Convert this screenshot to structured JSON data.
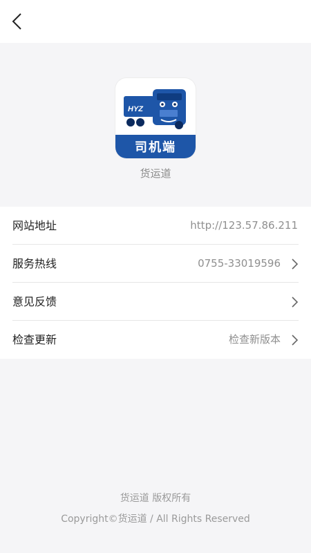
{
  "app": {
    "icon_band_text": "司机端",
    "icon_badge_text": "HYZ",
    "name": "货运道"
  },
  "list": {
    "items": [
      {
        "label": "网站地址",
        "value": "http://123.57.86.211",
        "icon": "none"
      },
      {
        "label": "服务热线",
        "value": "0755-33019596",
        "icon": "chevron-right-icon"
      },
      {
        "label": "意见反馈",
        "value": "",
        "icon": "chevron-right-icon"
      },
      {
        "label": "检查更新",
        "value": "检查新版本",
        "icon": "chevron-right-icon"
      }
    ]
  },
  "footer": {
    "line1": "货运道  版权所有",
    "line2": "Copyright©货运道 / All Rights Reserved"
  },
  "colors": {
    "brand_blue": "#1e56a8",
    "background": "#f5f5f7",
    "value_gray": "#8f8f8f"
  }
}
